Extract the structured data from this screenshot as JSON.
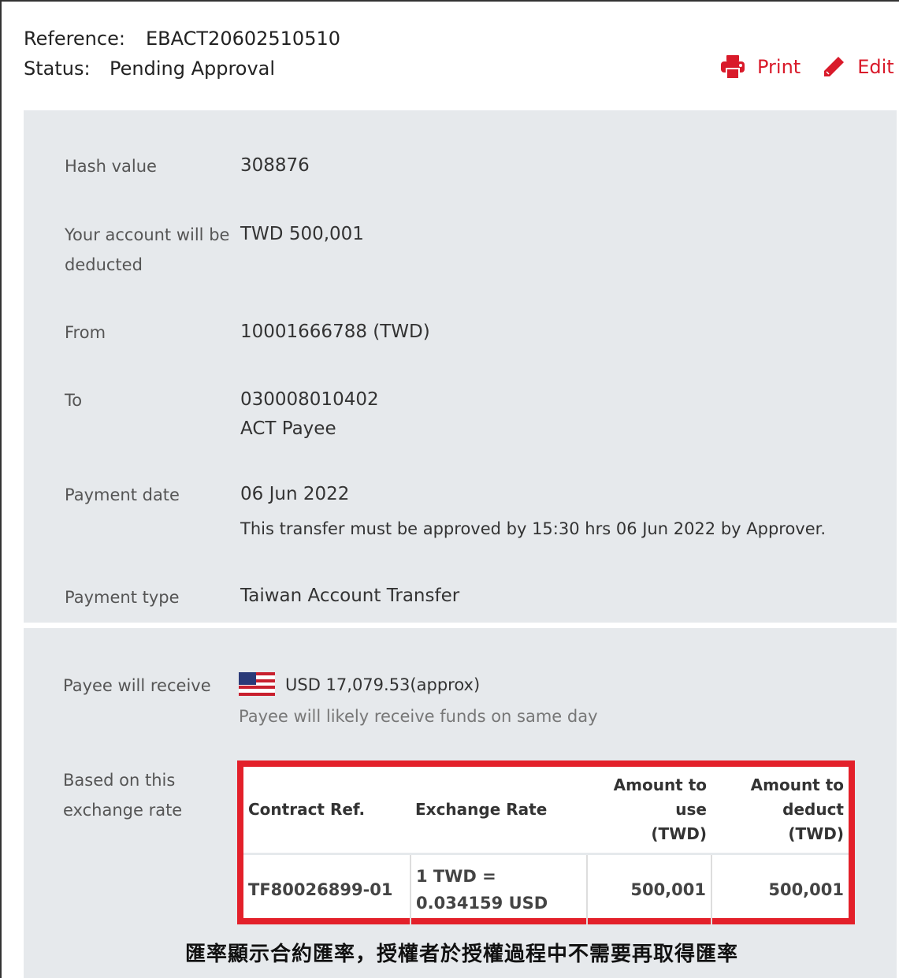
{
  "header": {
    "reference_label": "Reference:",
    "reference_value": "EBACT20602510510",
    "status_label": "Status:",
    "status_value": "Pending Approval"
  },
  "actions": {
    "print_label": "Print",
    "print_icon": "printer-icon",
    "edit_label": "Edit",
    "edit_icon": "pencil-icon",
    "accent_color": "#d91a2a"
  },
  "details": {
    "hash_label": "Hash value",
    "hash_value": "308876",
    "deducted_label_1": "Your account will be",
    "deducted_label_2": "deducted",
    "deducted_value": "TWD 500,001",
    "from_label": "From",
    "from_value": "10001666788 (TWD)",
    "to_label": "To",
    "to_account": "030008010402",
    "to_payee": "ACT Payee",
    "payment_date_label": "Payment date",
    "payment_date_value": "06 Jun 2022",
    "payment_date_note": "This transfer must be approved by 15:30 hrs 06 Jun 2022 by Approver.",
    "payment_type_label": "Payment type",
    "payment_type_value": "Taiwan Account Transfer"
  },
  "receive": {
    "label": "Payee will receive",
    "flag_icon": "us-flag-icon",
    "amount": "USD 17,079.53(approx)",
    "note": "Payee will likely receive funds on same day",
    "rate_label_1": "Based on this",
    "rate_label_2": "exchange rate"
  },
  "rates_table": {
    "headers": {
      "contract_ref": "Contract Ref.",
      "exchange_rate": "Exchange Rate",
      "amount_use_1": "Amount to",
      "amount_use_2": "use",
      "amount_use_3": "(TWD)",
      "amount_deduct_1": "Amount to",
      "amount_deduct_2": "deduct",
      "amount_deduct_3": "(TWD)"
    },
    "rows": [
      {
        "contract_ref": "TF80026899-01",
        "rate_line_1": "1 TWD =",
        "rate_line_2": "0.034159 USD",
        "amount_use": "500,001",
        "amount_deduct": "500,001"
      }
    ],
    "highlight_color": "#e3202a"
  },
  "caption": "匯率顯示合約匯率，授權者於授權過程中不需要再取得匯率"
}
